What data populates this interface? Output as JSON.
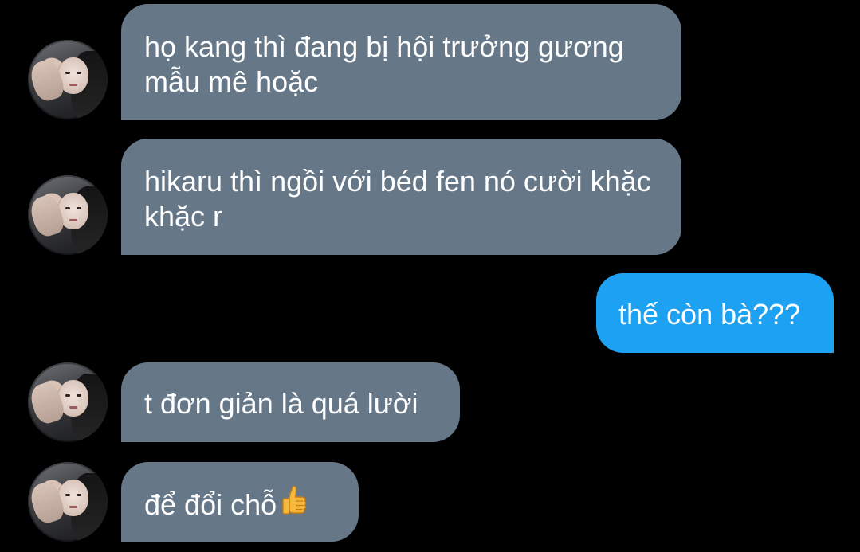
{
  "conversation": {
    "messages": [
      {
        "sender": "them",
        "avatar_icon": "profile-photo-avatar",
        "text": "họ kang thì đang bị hội trưởng gương mẫu mê hoặc"
      },
      {
        "sender": "them",
        "avatar_icon": "profile-photo-avatar",
        "text": "hikaru thì ngồi với béd fen nó cười khặc khặc r"
      },
      {
        "sender": "me",
        "text": "thế còn bà???"
      },
      {
        "sender": "them",
        "avatar_icon": "profile-photo-avatar",
        "text": "t đơn giản là quá lười"
      },
      {
        "sender": "them",
        "avatar_icon": "profile-photo-avatar",
        "text": "để đổi chỗ",
        "emoji": "thumbs-up-icon"
      }
    ]
  },
  "colors": {
    "background": "#000000",
    "incoming_bubble": "#667788",
    "outgoing_bubble": "#1da1f2",
    "text": "#ffffff"
  }
}
